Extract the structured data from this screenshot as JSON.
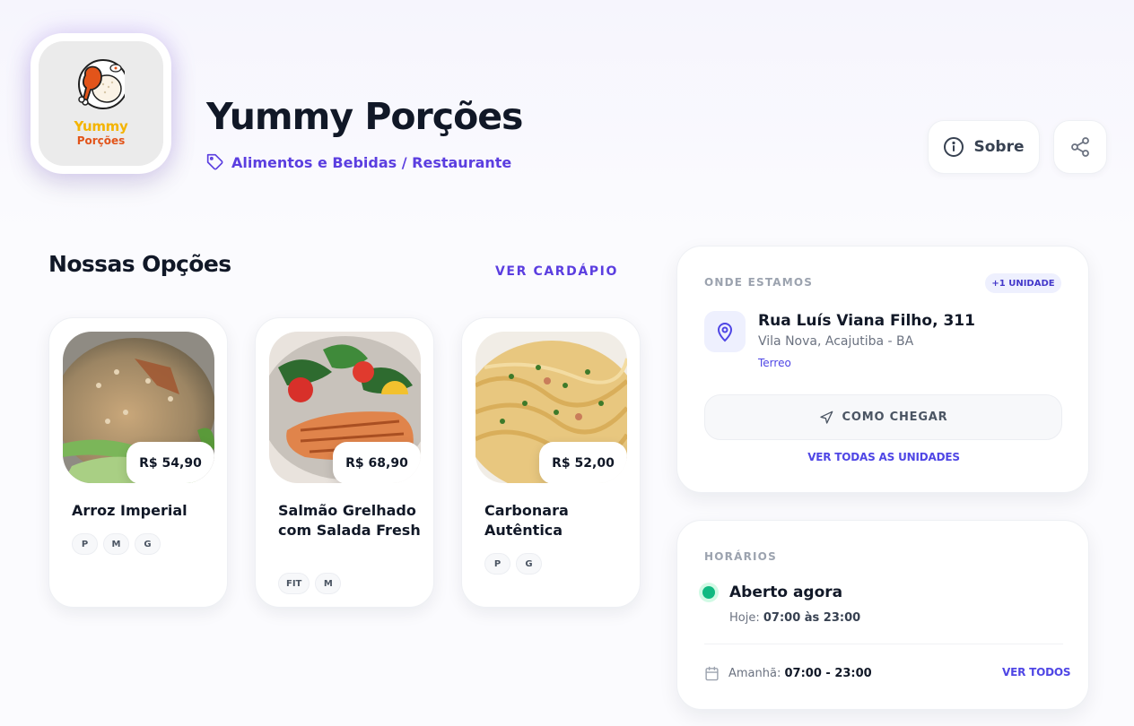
{
  "header": {
    "logo": {
      "line1": "Yummy",
      "line2": "Porções"
    },
    "title": "Yummy Porções",
    "category": "Alimentos e Bebidas / Restaurante",
    "about_label": "Sobre",
    "share_icon": "share-icon"
  },
  "options": {
    "title": "Nossas Opções",
    "menu_link": "VER CARDÁPIO",
    "items": [
      {
        "name": "Arroz Imperial",
        "price": "R$ 54,90",
        "tags": [
          "P",
          "M",
          "G"
        ]
      },
      {
        "name": "Salmão Grelhado com Salada Fresh",
        "price": "R$ 68,90",
        "tags": [
          "FIT",
          "M"
        ]
      },
      {
        "name": "Carbonara Autêntica",
        "price": "R$ 52,00",
        "tags": [
          "P",
          "G"
        ]
      }
    ]
  },
  "location": {
    "label": "ONDE ESTAMOS",
    "badge": "+1 UNIDADE",
    "street": "Rua Luís Viana Filho, 311",
    "city": "Vila Nova, Acajutiba - BA",
    "floor": "Terreo",
    "route_button": "COMO CHEGAR",
    "all_units": "VER TODAS AS UNIDADES"
  },
  "hours": {
    "label": "HORÁRIOS",
    "status": "Aberto agora",
    "today_label": "Hoje:",
    "today_value": "07:00 às 23:00",
    "tomorrow_label": "Amanhã:",
    "tomorrow_value": "07:00 - 23:00",
    "see_all": "VER TODOS"
  },
  "colors": {
    "accent": "#5b3ee0",
    "open_status": "#10b981"
  }
}
